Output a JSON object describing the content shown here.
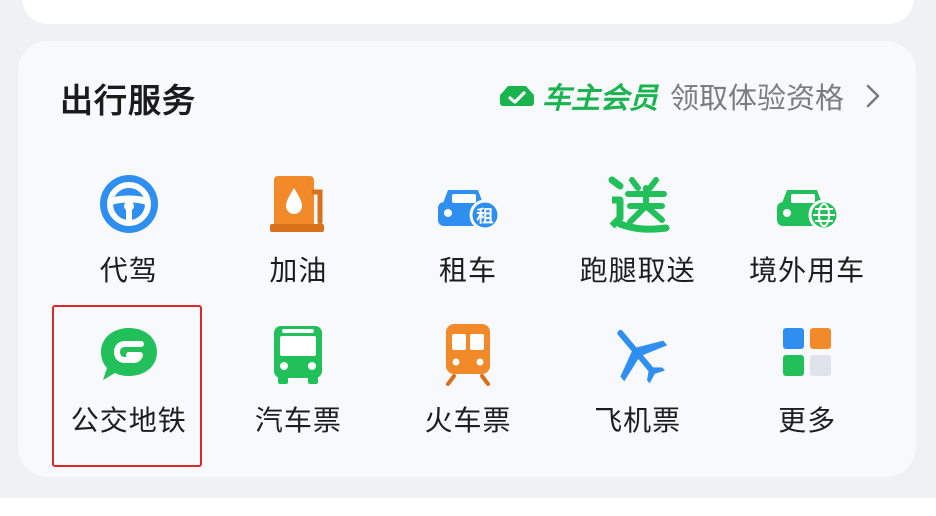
{
  "section": {
    "title": "出行服务",
    "promo_badge": "车主会员",
    "promo_cta": "领取体验资格"
  },
  "services": [
    {
      "label": "代驾",
      "icon": "steering-wheel-icon",
      "color": "#2e8ff0"
    },
    {
      "label": "加油",
      "icon": "gas-pump-icon",
      "color": "#f28a2a"
    },
    {
      "label": "租车",
      "icon": "rental-car-icon",
      "color": "#2e8ff0"
    },
    {
      "label": "跑腿取送",
      "icon": "delivery-icon",
      "color": "#22c05a"
    },
    {
      "label": "境外用车",
      "icon": "overseas-car-icon",
      "color": "#22c05a"
    },
    {
      "label": "公交地铁",
      "icon": "bus-metro-logo-icon",
      "color": "#22c05a"
    },
    {
      "label": "汽车票",
      "icon": "bus-icon",
      "color": "#22c05a"
    },
    {
      "label": "火车票",
      "icon": "train-icon",
      "color": "#f28a2a"
    },
    {
      "label": "飞机票",
      "icon": "airplane-icon",
      "color": "#2e8ff0"
    },
    {
      "label": "更多",
      "icon": "more-grid-icon",
      "color": "#2e8ff0"
    }
  ],
  "colors": {
    "accent_green": "#19b44e",
    "selection_border": "#e0252b",
    "background": "#eff1f5"
  }
}
